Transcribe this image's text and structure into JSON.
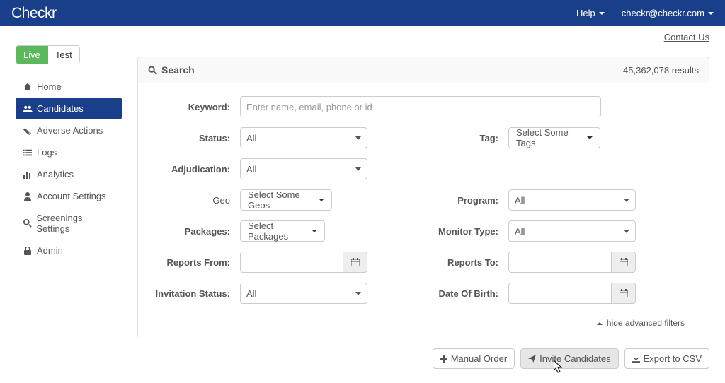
{
  "topbar": {
    "brand": "Checkr",
    "help": "Help",
    "user": "checkr@checkr.com"
  },
  "contact_us": "Contact Us",
  "tabs": {
    "live": "Live",
    "test": "Test"
  },
  "nav": {
    "home": "Home",
    "candidates": "Candidates",
    "adverse": "Adverse Actions",
    "logs": "Logs",
    "analytics": "Analytics",
    "account": "Account Settings",
    "screenings": "Screenings Settings",
    "admin": "Admin"
  },
  "search": {
    "title": "Search",
    "results": "45,362,078 results",
    "labels": {
      "keyword": "Keyword:",
      "status": "Status:",
      "adjudication": "Adjudication:",
      "geo": "Geo",
      "packages": "Packages:",
      "reports_from": "Reports From:",
      "invitation_status": "Invitation Status:",
      "tag": "Tag:",
      "program": "Program:",
      "monitor_type": "Monitor Type:",
      "reports_to": "Reports To:",
      "dob": "Date Of Birth:"
    },
    "keyword_placeholder": "Enter name, email, phone or id",
    "values": {
      "status": "All",
      "adjudication": "All",
      "geo": "Select Some Geos",
      "packages": "Select Packages",
      "invitation_status": "All",
      "tag": "Select Some Tags",
      "program": "All",
      "monitor_type": "All"
    },
    "hide_filters": "hide advanced filters"
  },
  "buttons": {
    "manual": "Manual Order",
    "invite": "Invite Candidates",
    "export": "Export to CSV"
  }
}
